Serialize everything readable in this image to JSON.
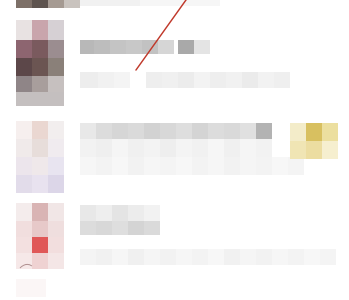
{
  "screen": {
    "title": ""
  },
  "theme": {
    "annotation_color": "#c0392b",
    "badge_color": "#d8c060"
  },
  "list": {
    "items": [
      {
        "state": "pixelated"
      },
      {
        "state": "pixelated"
      },
      {
        "state": "pixelated",
        "has_badge": true
      },
      {
        "state": "pixelated"
      }
    ]
  },
  "annotation": {
    "type": "red-pen-line"
  }
}
